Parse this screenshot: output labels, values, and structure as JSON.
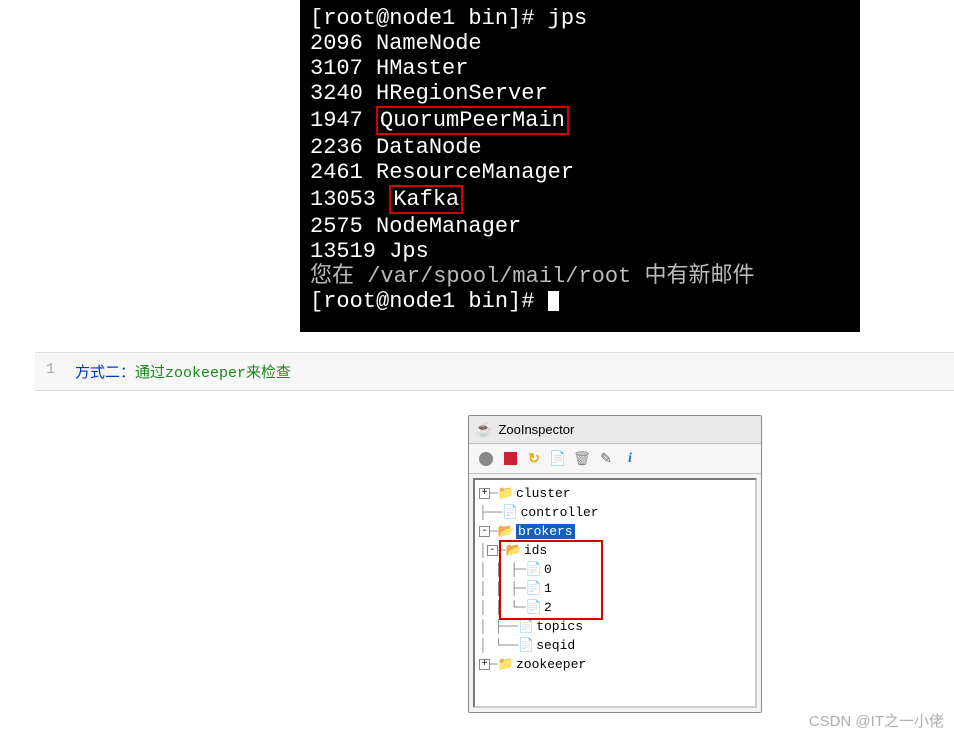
{
  "terminal": {
    "prompt_prefix": "[root@node1 bin]# ",
    "cmd": "jps",
    "lines": [
      {
        "pid": "2096",
        "name": "NameNode"
      },
      {
        "pid": "3107",
        "name": "HMaster"
      },
      {
        "pid": "3240",
        "name": "HRegionServer"
      },
      {
        "pid": "1947",
        "name": "QuorumPeerMain",
        "boxed": true
      },
      {
        "pid": "2236",
        "name": "DataNode"
      },
      {
        "pid": "2461",
        "name": "ResourceManager"
      },
      {
        "pid": "13053",
        "name": "Kafka",
        "boxed": true
      },
      {
        "pid": "2575",
        "name": "NodeManager"
      },
      {
        "pid": "13519",
        "name": "Jps"
      }
    ],
    "mail_msg_pre": "您在 ",
    "mail_path": "/var/spool/mail/root",
    "mail_msg_post": " 中有新邮件"
  },
  "codeblock": {
    "lineno": "1",
    "blue_text": "方式二：",
    "green_text": "通过zookeeper来检查"
  },
  "zoo": {
    "title": "ZooInspector",
    "toolbar": {
      "connect": "●",
      "stop": "■",
      "refresh": "↻",
      "newdoc": "✎",
      "delete": "🗑",
      "edit": "✏",
      "info": "i"
    },
    "tree": {
      "cluster": "cluster",
      "controller": "controller",
      "brokers": "brokers",
      "ids": "ids",
      "id0": "0",
      "id1": "1",
      "id2": "2",
      "topics": "topics",
      "seqid": "seqid",
      "zookeeper": "zookeeper"
    }
  },
  "watermark": "CSDN @IT之一小佬"
}
